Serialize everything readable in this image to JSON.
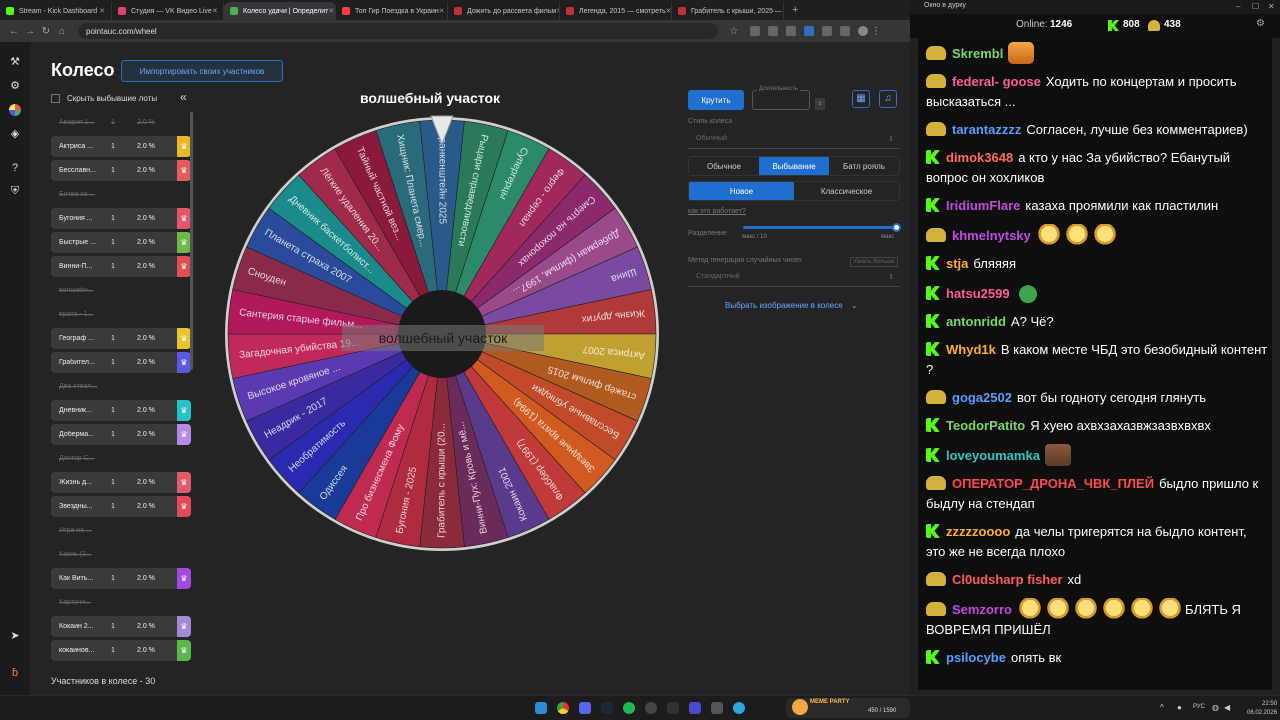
{
  "browser": {
    "tabs": [
      {
        "label": "Stream - Kick Dashboard",
        "color": "#53fc18",
        "active": false
      },
      {
        "label": "Студия — VK Видео Live",
        "color": "#e0446a",
        "active": false
      },
      {
        "label": "Колесо удачи | Определит",
        "color": "#4caf50",
        "active": true
      },
      {
        "label": "Топ Гир Поездка в Украин",
        "color": "#ff3d3d",
        "active": false
      },
      {
        "label": "Дожить до рассвета фильм",
        "color": "#b33",
        "active": false
      },
      {
        "label": "Легенда, 2015 — смотреть",
        "color": "#b33",
        "active": false
      },
      {
        "label": "Грабитель с крыши, 2025 —",
        "color": "#b33",
        "active": false
      }
    ],
    "url": "pointauc.com/wheel"
  },
  "app": {
    "title": "Колесо",
    "import_button": "Импортировать своих участников",
    "hide_dropped": "Скрыть выбывшие лоты",
    "collapse_icon": "«",
    "participants_count": "Участников в колесе - 30",
    "lots": [
      {
        "name": "Авария 1...",
        "qty": "1",
        "pct": "2.0 %",
        "out": true
      },
      {
        "name": "Актриса ...",
        "qty": "1",
        "pct": "2.0 %",
        "out": false,
        "color": "#e8b72a"
      },
      {
        "name": "Бесславн...",
        "qty": "1",
        "pct": "2.0 %",
        "out": false,
        "color": "#e55a5a"
      },
      {
        "name": "Битва за ...",
        "qty": "",
        "pct": "",
        "out": true
      },
      {
        "name": "Бугония ...",
        "qty": "1",
        "pct": "2.0 %",
        "out": false,
        "color": "#e0566b"
      },
      {
        "name": "Быстрые ...",
        "qty": "1",
        "pct": "2.0 %",
        "out": false,
        "color": "#6cb84a"
      },
      {
        "name": "Винни-П...",
        "qty": "1",
        "pct": "2.0 %",
        "out": false,
        "color": "#e05050"
      },
      {
        "name": "волшебн...",
        "qty": "",
        "pct": "",
        "out": true
      },
      {
        "name": "врата - 1...",
        "qty": "",
        "pct": "",
        "out": true
      },
      {
        "name": "Географ ...",
        "qty": "1",
        "pct": "2.0 %",
        "out": false,
        "color": "#e8c52a"
      },
      {
        "name": "Грабител...",
        "qty": "1",
        "pct": "2.0 %",
        "out": false,
        "color": "#5a5ae0"
      },
      {
        "name": "Два ствол...",
        "qty": "",
        "pct": "",
        "out": true
      },
      {
        "name": "Дневник...",
        "qty": "1",
        "pct": "2.0 %",
        "out": false,
        "color": "#25c2c8"
      },
      {
        "name": "Доберма...",
        "qty": "1",
        "pct": "2.0 %",
        "out": false,
        "color": "#b58ae8"
      },
      {
        "name": "Доктор С...",
        "qty": "",
        "pct": "",
        "out": true
      },
      {
        "name": "Жизнь д...",
        "qty": "1",
        "pct": "2.0 %",
        "out": false,
        "color": "#e05a6a"
      },
      {
        "name": "Звездны...",
        "qty": "1",
        "pct": "2.0 %",
        "out": false,
        "color": "#e04a5a"
      },
      {
        "name": "Игра на ...",
        "qty": "",
        "pct": "",
        "out": true
      },
      {
        "name": "Казнь (2...",
        "qty": "",
        "pct": "",
        "out": true
      },
      {
        "name": "Как Вить...",
        "qty": "1",
        "pct": "2.0 %",
        "out": false,
        "color": "#a04ae0"
      },
      {
        "name": "Карточн...",
        "qty": "",
        "pct": "",
        "out": true
      },
      {
        "name": "Кокаин 2...",
        "qty": "1",
        "pct": "2.0 %",
        "out": false,
        "color": "#a08ad8"
      },
      {
        "name": "кокаинов...",
        "qty": "1",
        "pct": "2.0 %",
        "out": false,
        "color": "#5ab84a"
      }
    ],
    "wheel_title": "волшебный участок",
    "center_label": "волшебный участок",
    "wheel_segments": [
      {
        "label": "Франкенштейн 2025",
        "color": "#2a5a8a"
      },
      {
        "label": "Рыцари справедливости",
        "color": "#2a7a5a"
      },
      {
        "label": "Супергерцы",
        "color": "#2a8a6a"
      },
      {
        "label": "Ферго - сериал",
        "color": "#a0285a"
      },
      {
        "label": "Смерть на похоронах",
        "color": "#8a2a6a"
      },
      {
        "label": "Доберман (фильм, 1997...",
        "color": "#9a4a8a"
      },
      {
        "label": "Шина",
        "color": "#7a4aa0"
      },
      {
        "label": "Жизнь других",
        "color": "#b03a3a"
      },
      {
        "label": "Актриса 2007",
        "color": "#c0a030"
      },
      {
        "label": "стажёр фильм 2015",
        "color": "#b05a20"
      },
      {
        "label": "Бесславные ублюдки",
        "color": "#c04a2a"
      },
      {
        "label": "Звездные врата (1994)",
        "color": "#d05a20"
      },
      {
        "label": "Флаббер (1997)",
        "color": "#c03a3a"
      },
      {
        "label": "Кокаин 2001",
        "color": "#5a3a8a"
      },
      {
        "label": "Винни-Пух: Кровь и мё...",
        "color": "#6a2a5a"
      },
      {
        "label": "Грабитель с крыши (20...",
        "color": "#8a2a3a"
      },
      {
        "label": "Бугония - 2025",
        "color": "#b02a40"
      },
      {
        "label": "Про бизнесмена Фому",
        "color": "#c02a50"
      },
      {
        "label": "Одиссея",
        "color": "#1a3a9a"
      },
      {
        "label": "Необратимость",
        "color": "#2a2ab0"
      },
      {
        "label": "Неадрик - 2017",
        "color": "#3a2aa0"
      },
      {
        "label": "Высокое кровяное ...",
        "color": "#5a3ab0"
      },
      {
        "label": "Загадочная убийства 19...",
        "color": "#c02a5a"
      },
      {
        "label": "Сантерия старые фильм...",
        "color": "#b01a5a"
      },
      {
        "label": "Сноуден",
        "color": "#8a2a4a"
      },
      {
        "label": "Планета страха 2007",
        "color": "#2a4a9a"
      },
      {
        "label": "Дневник баскетболист...",
        "color": "#1a8a8a"
      },
      {
        "label": "Лёгкие удаления 20...",
        "color": "#a02a4a"
      },
      {
        "label": "Тайный частной вез...",
        "color": "#8a1a3a"
      },
      {
        "label": "Хищник: Планета смер...",
        "color": "#2a6a7a"
      }
    ],
    "controls": {
      "spin": "Крутить",
      "duration_label": "Длительность",
      "duration_value": "",
      "duration_unit": "с",
      "wheel_style_label": "Стиль колеса",
      "wheel_style_value": "Обычный",
      "modes": [
        "Обычное",
        "Выбывание",
        "Батл рояль"
      ],
      "mode_active": 1,
      "variants": [
        "Новое",
        "Классическое"
      ],
      "variant_active": 0,
      "how_link": "как это работает?",
      "split_label": "Разделение",
      "slider_min": "макс / 10",
      "slider_max": "макс",
      "slider_value": 1.0,
      "rng_label": "Метод генерации случайных чисел",
      "rng_more": "Узнать больше",
      "rng_value": "Стандартный",
      "choose_image": "Выбрать изображение в колесе",
      "choose_image_chevron": "⌄",
      "icon_grid": "grid-icon",
      "icon_music": "music-icon"
    }
  },
  "taskbar": {
    "meme_party": "MEME PARTY",
    "meme_count": "450 / 1590",
    "lang": "РУС",
    "time": "22:50",
    "date": "06.02.2026"
  },
  "chat": {
    "window_title": "Окно в дурку",
    "online_label": "Online:",
    "online_count": "1246",
    "kick_count": "808",
    "sub_count": "438",
    "messages": [
      {
        "badge": "sub",
        "user": "Skrembl",
        "color": "#7cd66a",
        "text": "",
        "emotes": [
          "tiger"
        ]
      },
      {
        "badge": "sub",
        "user": "federal- goose",
        "color": "#ff5c9a",
        "text": "Ходить по концертам и просить высказаться ...",
        "emotes": []
      },
      {
        "badge": "sub",
        "user": "tarantazzzz",
        "color": "#5a9cff",
        "text": "Согласен, лучше без комментариев)",
        "emotes": []
      },
      {
        "badge": "kick",
        "user": "dimok3648",
        "color": "#ff6a5a",
        "text": "а кто у нас За убийство? Ебанутый вопрос он хохликов",
        "emotes": []
      },
      {
        "badge": "kick",
        "user": "IridiumFlare",
        "color": "#c04ae0",
        "text": "казаха проямили как пластилин",
        "emotes": []
      },
      {
        "badge": "sub",
        "user": "khmelnytsky",
        "color": "#c04ae0",
        "text": "",
        "emotes": [
          "laugh",
          "laugh",
          "laugh"
        ]
      },
      {
        "badge": "kick",
        "user": "stja",
        "color": "#ffb02a",
        "text": "бляяяя",
        "emotes": []
      },
      {
        "badge": "kick",
        "user": "hatsu2599",
        "color": "#ff5c9a",
        "text": "",
        "emotes": [
          "frog"
        ]
      },
      {
        "badge": "kick",
        "user": "antonridd",
        "color": "#7cd66a",
        "text": "А? Чё?",
        "emotes": []
      },
      {
        "badge": "kick",
        "user": "Whyd1k",
        "color": "#ffb02a",
        "text": "В каком месте ЧБД это безобидный контент ?",
        "emotes": []
      },
      {
        "badge": "sub",
        "user": "goga2502",
        "color": "#5a9cff",
        "text": "вот бы годноту сегодня глянуть",
        "emotes": []
      },
      {
        "badge": "kick",
        "user": "TeodorPatito",
        "color": "#7cd66a",
        "text": "Я хуею ахвхзахазвжзазвхвхвх",
        "emotes": []
      },
      {
        "badge": "kick",
        "user": "loveyoumamka",
        "color": "#2ac8c8",
        "text": "",
        "emotes": [
          "face"
        ]
      },
      {
        "badge": "sub",
        "user": "ОПЕРАТОР_ДРОНА_ЧВК_ПЛЕЙ",
        "color": "#ff4a4a",
        "text": "быдло пришло к быдлу на стендап",
        "emotes": []
      },
      {
        "badge": "kick",
        "user": "zzzzzoooo",
        "color": "#ffb02a",
        "text": "да челы тригерятся на быдло контент, это же не всегда плохо",
        "emotes": []
      },
      {
        "badge": "sub",
        "user": "Cl0udsharp fisher",
        "color": "#ff5c5c",
        "text": "xd",
        "emotes": []
      },
      {
        "badge": "sub",
        "user": "Semzorro",
        "color": "#c04ae0",
        "text": "БЛЯТЬ Я ВОВРЕМЯ ПРИШЁЛ",
        "emotes": [
          "laugh",
          "laugh",
          "laugh",
          "laugh",
          "laugh",
          "laugh"
        ]
      },
      {
        "badge": "kick",
        "user": "psilocybe",
        "color": "#5a9cff",
        "text": "опять вк",
        "emotes": []
      }
    ]
  }
}
